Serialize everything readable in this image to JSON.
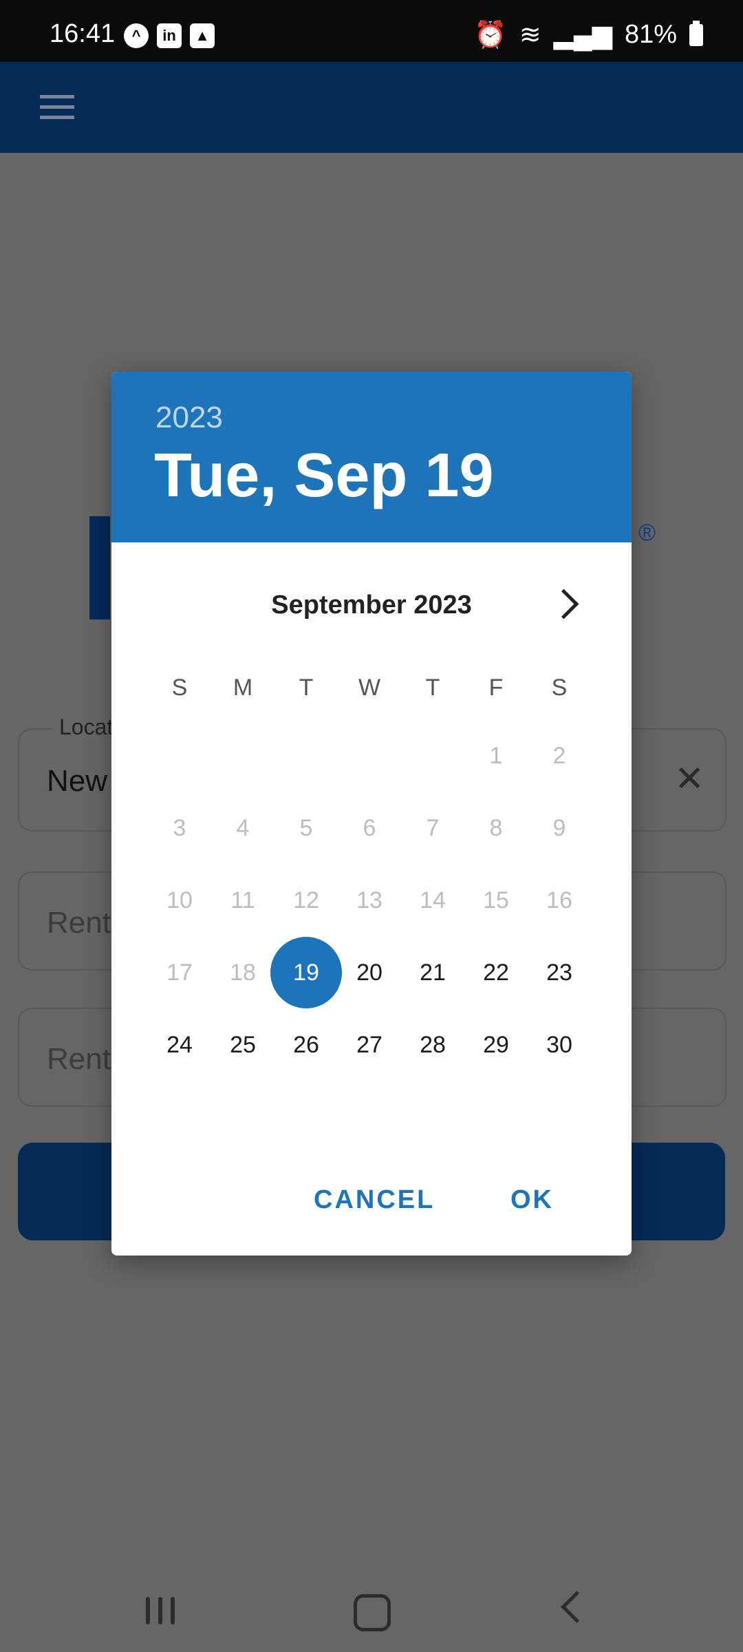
{
  "status_bar": {
    "time": "16:41",
    "battery": "81%",
    "left_icons": [
      "app-icon",
      "linkedin-icon",
      "image-icon"
    ],
    "right_icons": [
      "alarm-icon",
      "wifi-icon",
      "signal-icon",
      "battery-icon"
    ]
  },
  "background": {
    "location_field": {
      "legend": "Locat",
      "value": "New"
    },
    "rent_field_1": {
      "placeholder": "Rent"
    },
    "rent_field_2": {
      "placeholder": "Rent"
    },
    "registered_mark": "®"
  },
  "dialog": {
    "year": "2023",
    "selected_date": "Tue, Sep 19",
    "month_label": "September 2023",
    "weekdays": [
      "S",
      "M",
      "T",
      "W",
      "T",
      "F",
      "S"
    ],
    "days": [
      "1",
      "2",
      "3",
      "4",
      "5",
      "6",
      "7",
      "8",
      "9",
      "10",
      "11",
      "12",
      "13",
      "14",
      "15",
      "16",
      "17",
      "18",
      "19",
      "20",
      "21",
      "22",
      "23",
      "24",
      "25",
      "26",
      "27",
      "28",
      "29",
      "30"
    ],
    "first_weekday_index": 5,
    "selected_day": 19,
    "first_enabled_day": 19,
    "cancel_label": "CANCEL",
    "ok_label": "OK"
  },
  "colors": {
    "accent": "#1e74b8",
    "app_bar": "#052a56",
    "scrim": "#666666"
  }
}
